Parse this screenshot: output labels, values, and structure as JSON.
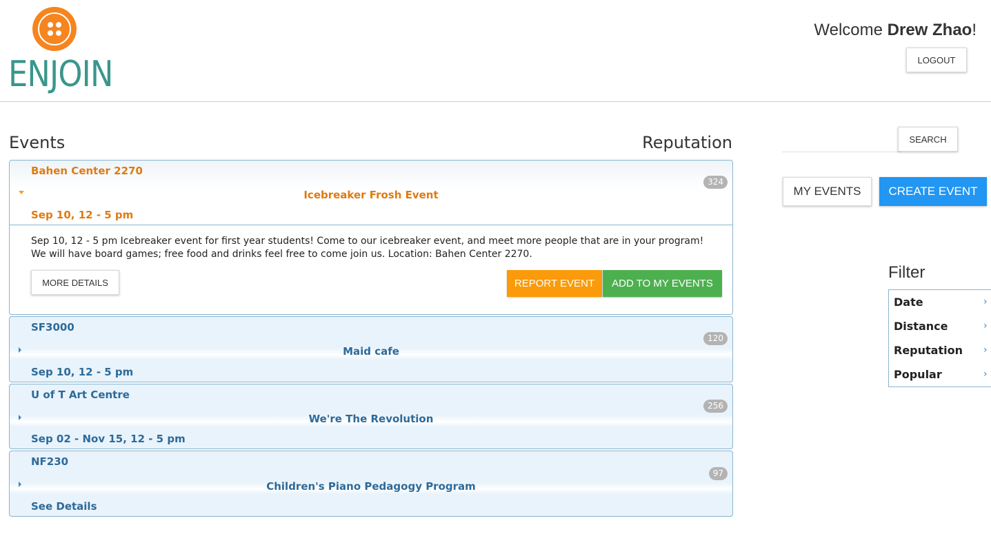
{
  "header": {
    "logo_text": "ENJOIN",
    "welcome_prefix": "Welcome ",
    "user_name": "Drew Zhao",
    "welcome_suffix": "!",
    "logout_label": "LOGOUT"
  },
  "columns": {
    "events_heading": "Events",
    "reputation_heading": "Reputation"
  },
  "events": [
    {
      "location": "Bahen Center 2270",
      "title": "Icebreaker Frosh Event",
      "date": "Sep 10, 12 - 5 pm",
      "reputation": "324",
      "expanded": true,
      "description": "Sep 10, 12 - 5 pm Icebreaker event for first year students! Come to our icebreaker event, and meet more people that are in your program! We will have board games; free food and drinks feel free to come join us. Location: Bahen Center 2270.",
      "more_details_label": "MORE DETAILS",
      "report_label": "REPORT EVENT",
      "add_label": "ADD TO MY EVENTS"
    },
    {
      "location": "SF3000",
      "title": "Maid cafe",
      "date": "Sep 10, 12 - 5 pm",
      "reputation": "120",
      "expanded": false
    },
    {
      "location": "U of T Art Centre",
      "title": "We're The Revolution",
      "date": "Sep 02 - Nov 15, 12 - 5 pm",
      "reputation": "256",
      "expanded": false
    },
    {
      "location": "NF230",
      "title": "Children's Piano Pedagogy Program",
      "date": "See Details",
      "reputation": "97",
      "expanded": false
    }
  ],
  "sidebar": {
    "search_placeholder": "",
    "search_label": "SEARCH",
    "my_events_label": "MY EVENTS",
    "create_event_label": "CREATE EVENT",
    "filter_heading": "Filter",
    "filters": [
      "Date",
      "Distance",
      "Reputation",
      "Popular"
    ]
  },
  "colors": {
    "brand_orange": "#f6851f",
    "brand_teal": "#3a968c",
    "report_orange": "#fb9a0a",
    "add_green": "#4db04f",
    "create_blue": "#2196f3",
    "event_text_blue": "#2d6a99",
    "active_text_orange": "#e07a10"
  }
}
